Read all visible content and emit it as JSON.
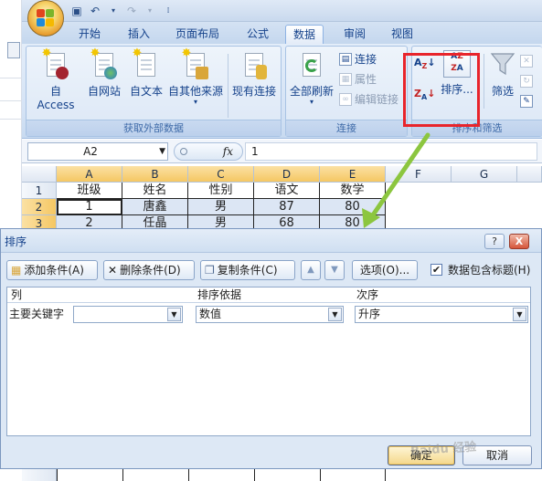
{
  "ribbon": {
    "tabs": [
      "开始",
      "插入",
      "页面布局",
      "公式",
      "数据",
      "审阅",
      "视图"
    ],
    "active_tab": "数据",
    "get_external": {
      "buttons": [
        "自 Access",
        "自网站",
        "自文本",
        "自其他来源",
        "现有连接"
      ],
      "label": "获取外部数据"
    },
    "connections": {
      "refresh_label": "全部刷新",
      "connect_label": "连接",
      "props_label": "属性",
      "edit_links_label": "编辑链接",
      "label": "连接"
    },
    "sort_filter": {
      "sort_label": "排序...",
      "filter_label": "筛选",
      "label": "排序和筛选"
    }
  },
  "formula_bar": {
    "name_box": "A2",
    "fx": "fx",
    "formula": "1"
  },
  "sheet": {
    "columns": [
      "A",
      "B",
      "C",
      "D",
      "E",
      "F",
      "G"
    ],
    "rows": [
      "1",
      "2",
      "3"
    ],
    "cells": [
      [
        "班级",
        "姓名",
        "性别",
        "语文",
        "数学"
      ],
      [
        "1",
        "唐鑫",
        "男",
        "87",
        "80"
      ],
      [
        "2",
        "任晶",
        "男",
        "68",
        "80"
      ]
    ]
  },
  "dialog": {
    "title": "排序",
    "help": "?",
    "close": "X",
    "add_condition": "添加条件(A)",
    "delete_condition": "删除条件(D)",
    "copy_condition": "复制条件(C)",
    "options": "选项(O)...",
    "has_headers_label": "数据包含标题(H)",
    "has_headers_checked": "✔",
    "col_header": "列",
    "sort_on_header": "排序依据",
    "order_header": "次序",
    "primary_key_label": "主要关键字",
    "primary_key_value": "",
    "sort_on_value": "数值",
    "order_value": "升序",
    "ok": "确定",
    "cancel": "取消"
  },
  "watermark": "Baidu 经验",
  "colors": {
    "highlight_box": "#e8242b",
    "arrow": "#8cc63f",
    "ribbon_bg": "#d5e3f5",
    "dialog_bg": "#dde8f5"
  }
}
